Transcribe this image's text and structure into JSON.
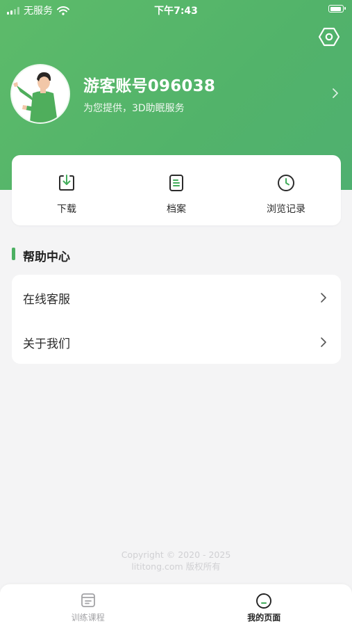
{
  "status_bar": {
    "carrier": "无服务",
    "time": "下午7:43"
  },
  "header": {
    "settings_icon": "gear-hexagon-icon",
    "user_name": "游客账号096038",
    "user_subtitle": "为您提供，3D助眠服务"
  },
  "quick_actions": [
    {
      "label": "下载",
      "icon": "download-icon"
    },
    {
      "label": "档案",
      "icon": "document-icon"
    },
    {
      "label": "浏览记录",
      "icon": "clock-icon"
    }
  ],
  "help_center": {
    "title": "帮助中心",
    "items": [
      {
        "label": "在线客服"
      },
      {
        "label": "关于我们"
      }
    ]
  },
  "footer": {
    "copyright_line1": "Copyright © 2020 - 2025",
    "copyright_line2": "lititong.com 版权所有"
  },
  "tabbar": {
    "items": [
      {
        "label": "训练课程",
        "icon": "course-icon",
        "active": false
      },
      {
        "label": "我的页面",
        "icon": "profile-icon",
        "active": true
      }
    ]
  },
  "colors": {
    "brand_green": "#52b36a",
    "background": "#f4f4f5"
  }
}
